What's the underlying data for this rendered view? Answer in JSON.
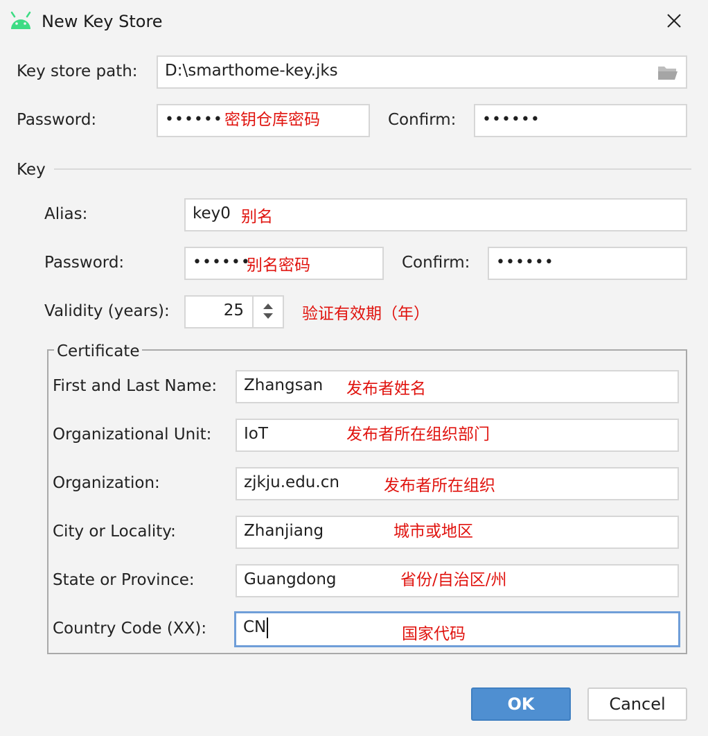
{
  "window": {
    "title": "New Key Store",
    "icon": "android-icon",
    "close_icon": "close-icon"
  },
  "keystore": {
    "path_label": "Key store path:",
    "path_value": "D:\\smarthome-key.jks",
    "folder_icon": "folder-icon",
    "password_label": "Password:",
    "password_value": "••••••",
    "password_note": "密钥仓库密码",
    "confirm_label": "Confirm:",
    "confirm_value": "••••••"
  },
  "key": {
    "section_label": "Key",
    "alias_label": "Alias:",
    "alias_value": "key0",
    "alias_note": "别名",
    "password_label": "Password:",
    "password_value": "••••••",
    "password_note": "别名密码",
    "confirm_label": "Confirm:",
    "confirm_value": "••••••",
    "validity_label": "Validity (years):",
    "validity_value": "25",
    "validity_note": "验证有效期（年）"
  },
  "certificate": {
    "legend": "Certificate",
    "rows": [
      {
        "label": "First and Last Name:",
        "value": "Zhangsan",
        "note": "发布者姓名"
      },
      {
        "label": "Organizational Unit:",
        "value": "IoT",
        "note": "发布者所在组织部门"
      },
      {
        "label": "Organization:",
        "value": "zjkju.edu.cn",
        "note": "发布者所在组织"
      },
      {
        "label": "City or Locality:",
        "value": "Zhanjiang",
        "note": "城市或地区"
      },
      {
        "label": "State or Province:",
        "value": "Guangdong",
        "note": "省份/自治区/州"
      },
      {
        "label": "Country Code (XX):",
        "value": "CN",
        "note": "国家代码"
      }
    ]
  },
  "buttons": {
    "ok": "OK",
    "cancel": "Cancel"
  },
  "colors": {
    "accent": "#4f8fd1",
    "annotation": "#e0130e",
    "android_green": "#3ddc84"
  }
}
